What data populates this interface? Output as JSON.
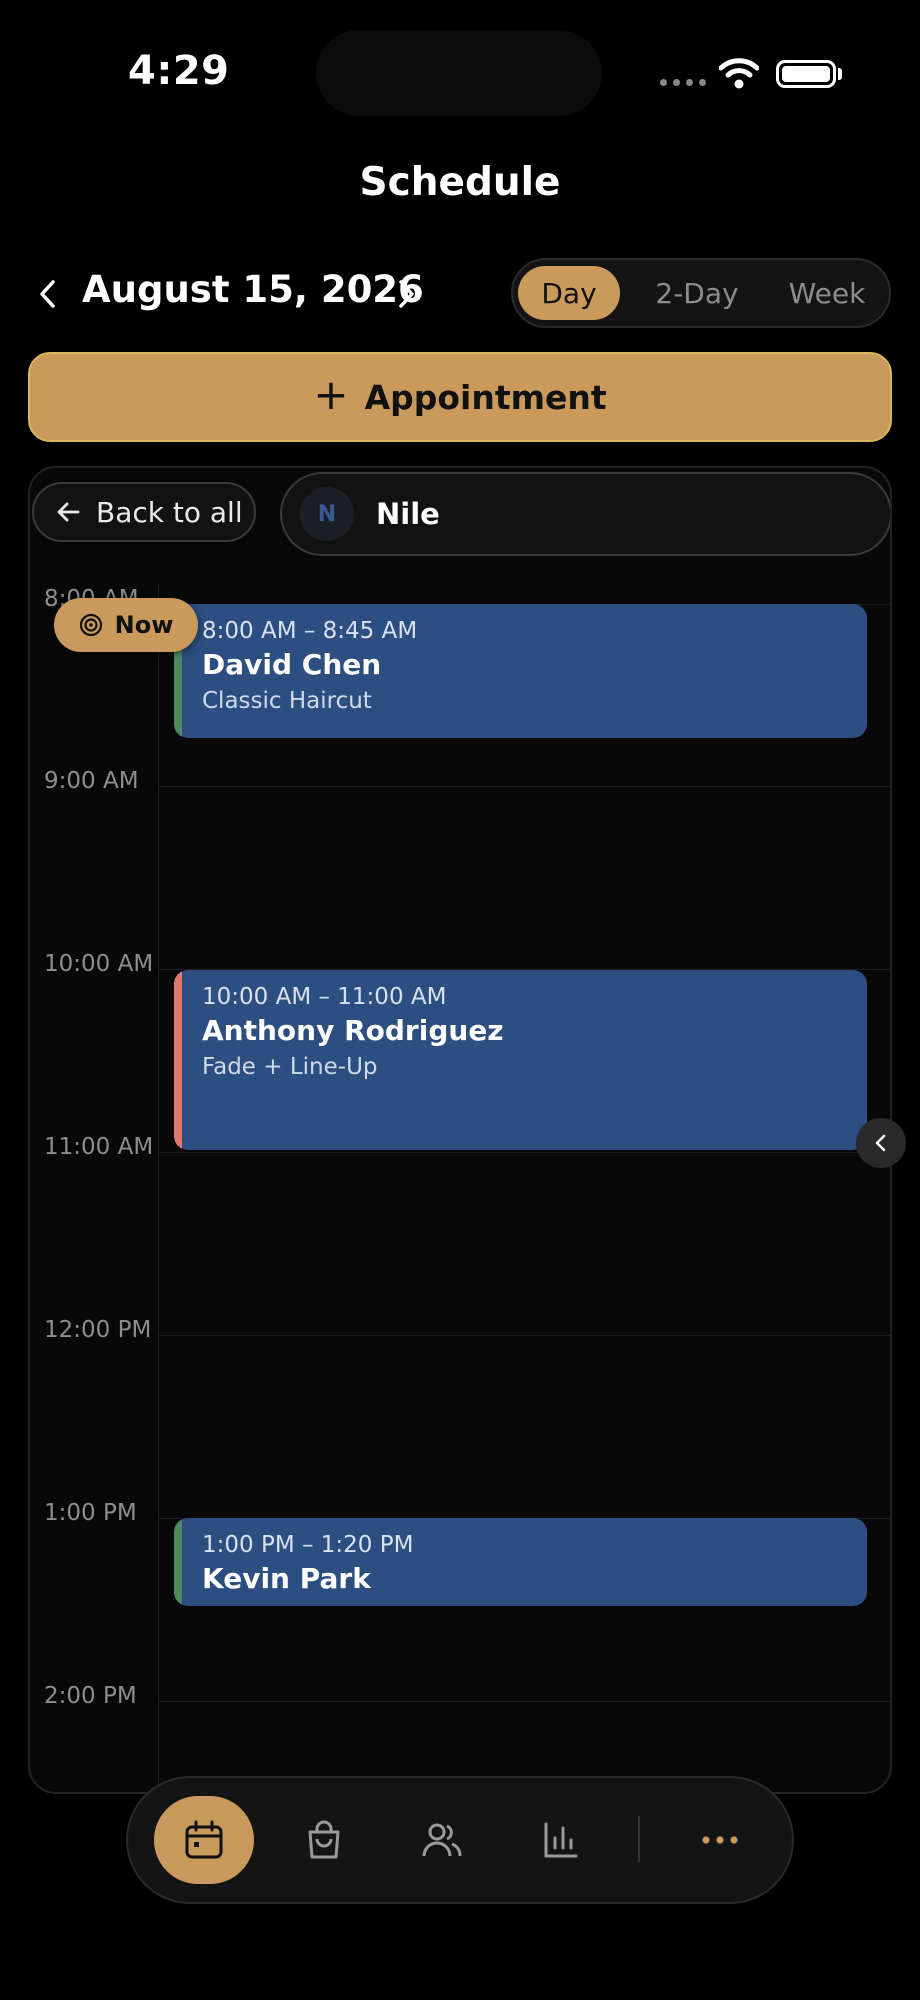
{
  "status_bar": {
    "time": "4:29"
  },
  "header": {
    "title": "Schedule",
    "date": "August 15, 2026",
    "view_options": [
      "Day",
      "2-Day",
      "Week"
    ],
    "selected_view": "Day"
  },
  "actions": {
    "add_appointment_label": "Appointment"
  },
  "filter": {
    "back_label": "Back to all",
    "staff_initial": "N",
    "staff_name": "Nile"
  },
  "timeline": {
    "hours": [
      "8:00 AM",
      "9:00 AM",
      "10:00 AM",
      "11:00 AM",
      "12:00 PM",
      "1:00 PM",
      "2:00 PM"
    ],
    "now_label": "Now"
  },
  "appointments": [
    {
      "time": "8:00 AM – 8:45 AM",
      "client": "David Chen",
      "service": "Classic Haircut",
      "accent": "#4e8a5f"
    },
    {
      "time": "10:00 AM – 11:00 AM",
      "client": "Anthony Rodriguez",
      "service": "Fade + Line-Up",
      "accent": "#e07a6a"
    },
    {
      "time": "1:00 PM – 1:20 PM",
      "client": "Kevin Park",
      "service": "",
      "accent": "#4e8a5f"
    }
  ],
  "tabbar": {
    "items": [
      "calendar-icon",
      "shopping-bag-icon",
      "users-icon",
      "bar-chart-icon",
      "more-icon"
    ],
    "active": "calendar-icon"
  },
  "colors": {
    "accent": "#c99a5b",
    "event_bg": "#2c4e80",
    "background": "#000000"
  }
}
